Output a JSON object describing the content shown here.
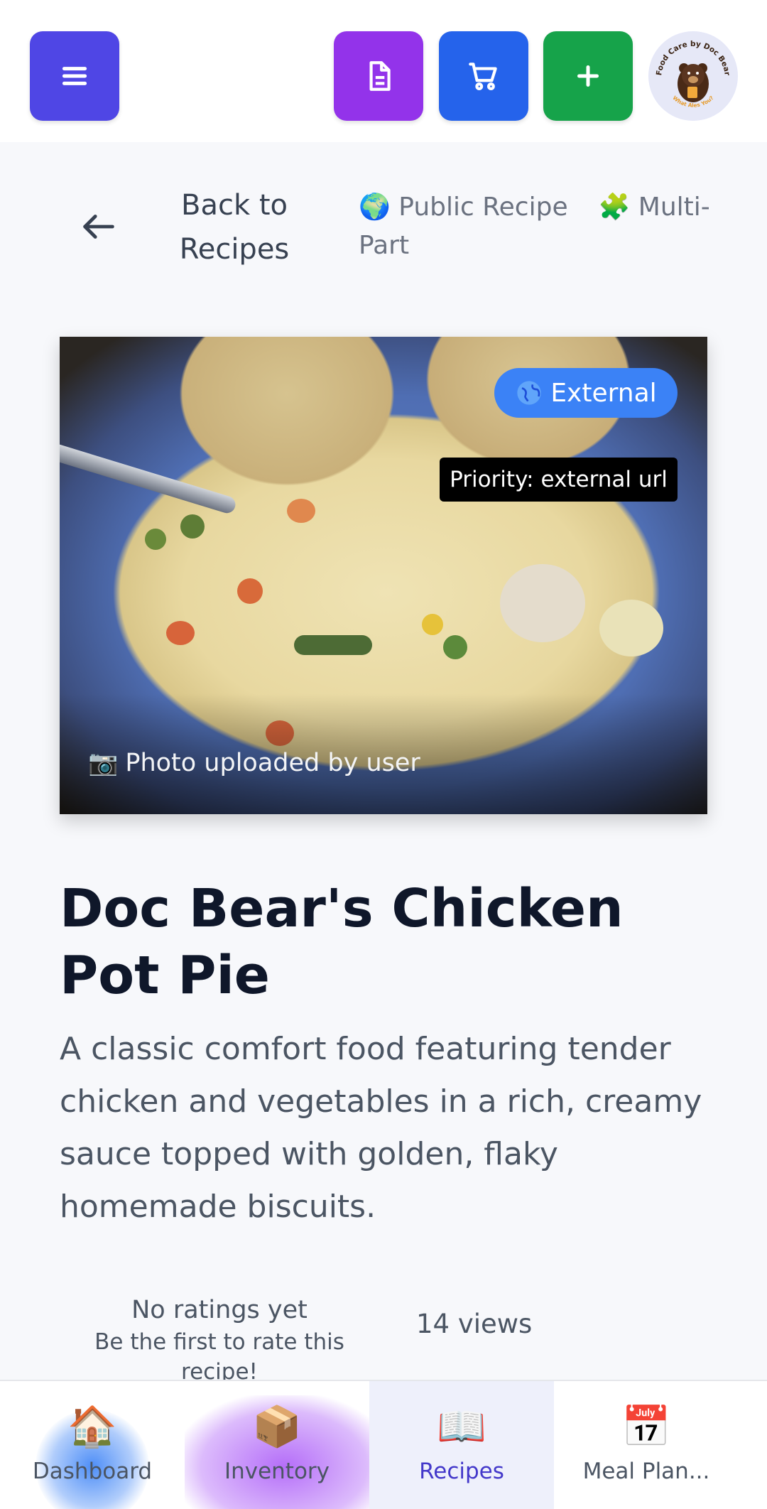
{
  "header": {
    "menu_icon": "hamburger-menu-icon",
    "doc_icon": "document-icon",
    "cart_icon": "shopping-cart-icon",
    "add_icon": "plus-icon",
    "logo_text_top": "Food Care by Doc Bear",
    "logo_text_bottom": "What Ales You?",
    "colors": {
      "menu": "#4f46e5",
      "doc": "#9333ea",
      "cart": "#2563eb",
      "add": "#16a34a"
    }
  },
  "back": {
    "label": "Back to Recipes",
    "badges": [
      {
        "icon": "🌍",
        "text": "Public Recipe"
      },
      {
        "icon": "🧩",
        "text": "Multi-Part"
      }
    ]
  },
  "hero": {
    "source_badge": "External",
    "priority": "Priority: external url",
    "caption_icon": "📷",
    "caption": "Photo uploaded by user"
  },
  "recipe": {
    "title": "Doc Bear's Chicken Pot Pie",
    "description": "A classic comfort food featuring tender chicken and vegetables in a rich, creamy sauce topped with golden, flaky homemade biscuits."
  },
  "stats": {
    "ratings_title": "No ratings yet",
    "ratings_sub": "Be the first to rate this recipe!",
    "views": "14 views"
  },
  "nav": {
    "items": [
      {
        "icon": "🏠",
        "label": "Dashboard"
      },
      {
        "icon": "📦",
        "label": "Inventory"
      },
      {
        "icon": "📖",
        "label": "Recipes",
        "active": true
      },
      {
        "icon": "📅",
        "label": "Meal Plan..."
      }
    ]
  }
}
